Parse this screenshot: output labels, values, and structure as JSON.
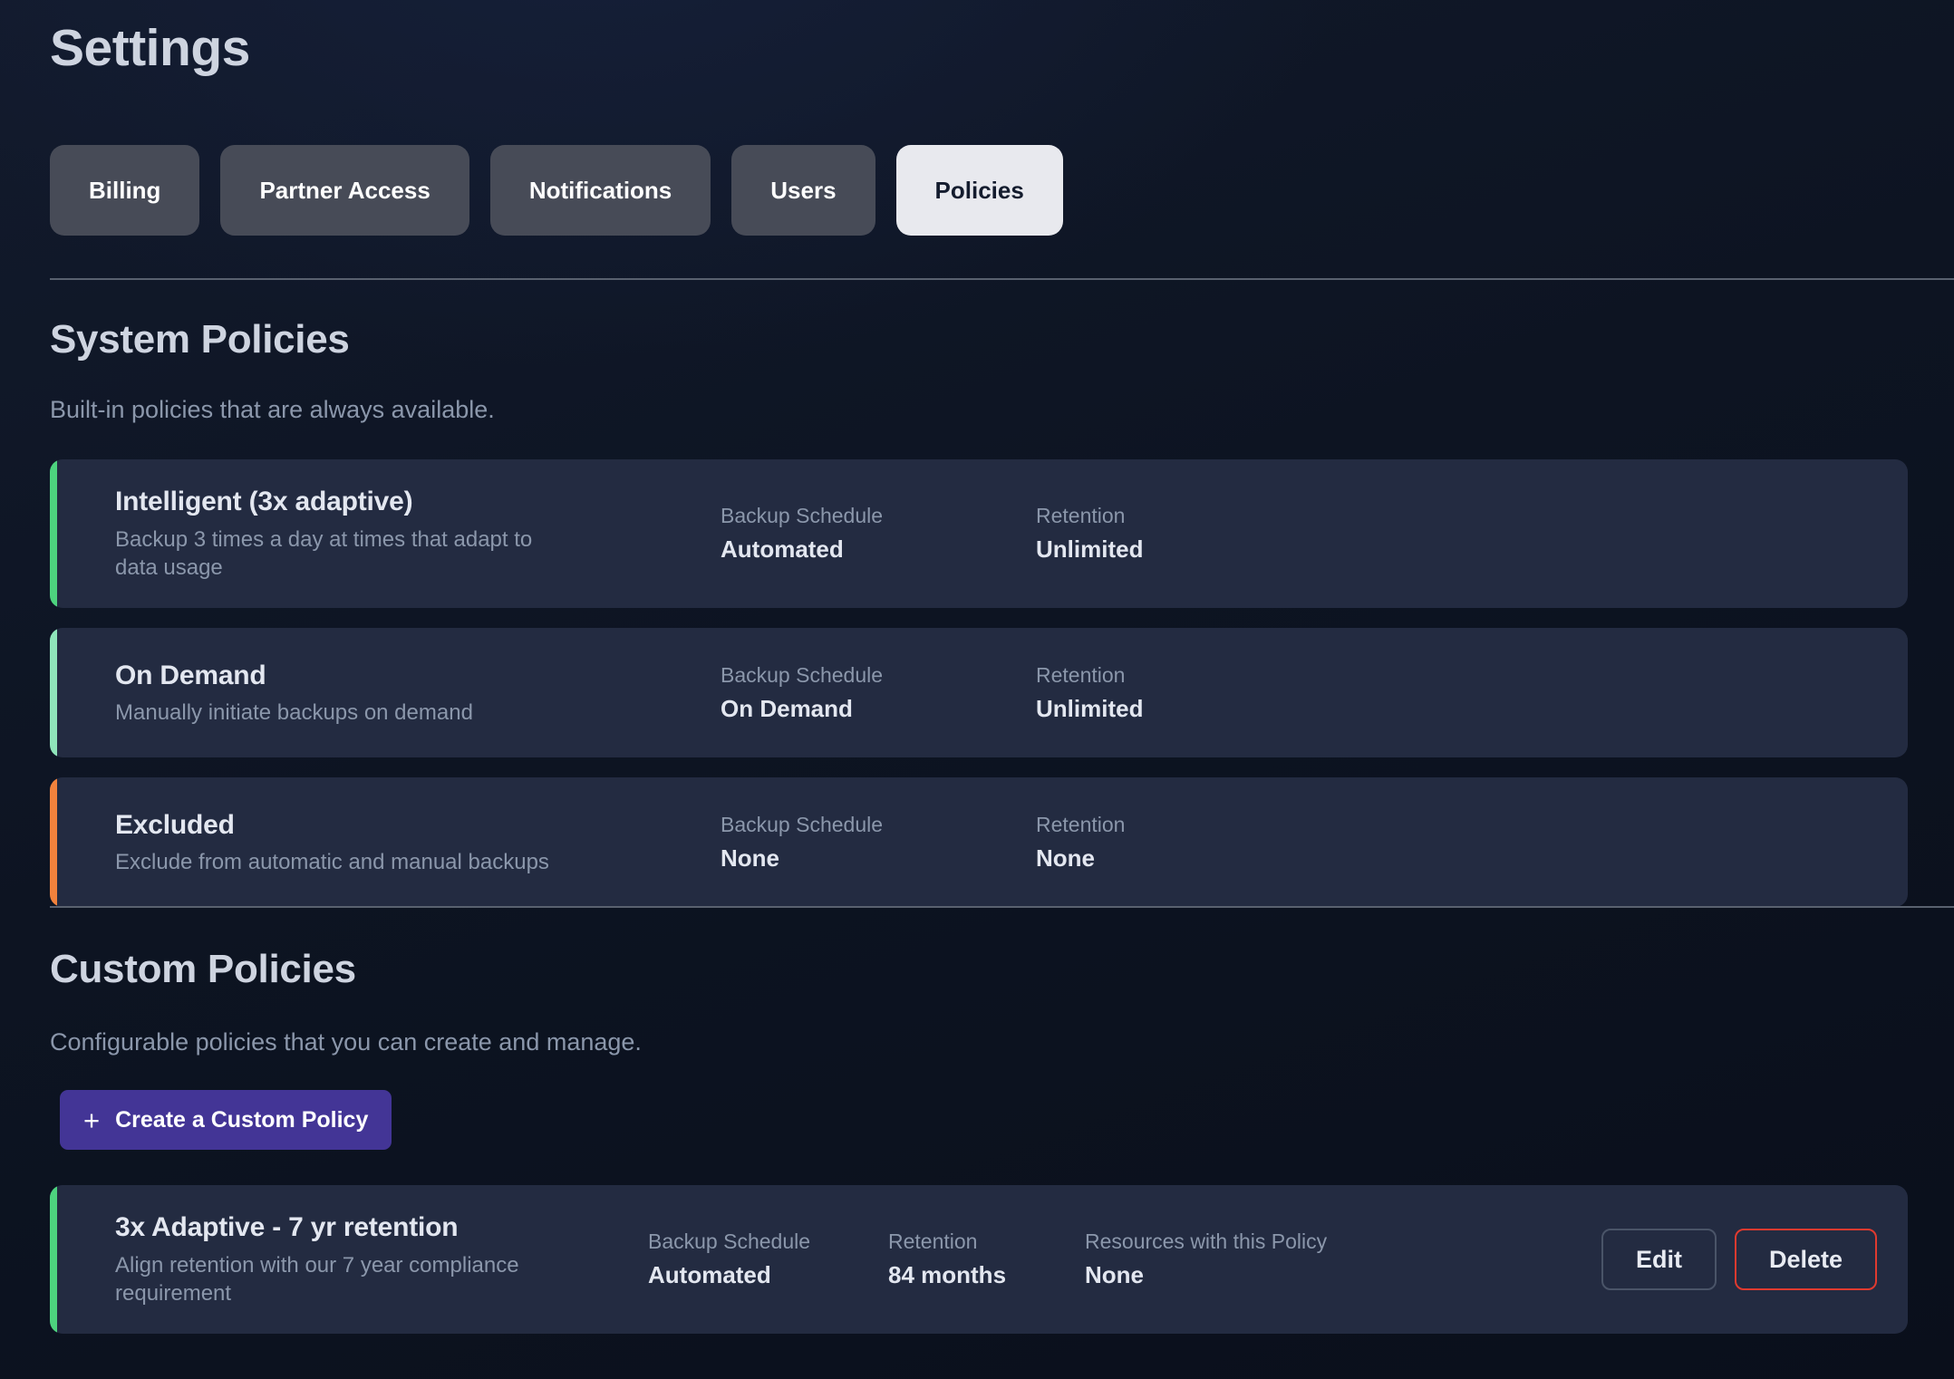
{
  "header": {
    "title": "Settings"
  },
  "tabs": [
    {
      "label": "Billing",
      "active": false
    },
    {
      "label": "Partner Access",
      "active": false
    },
    {
      "label": "Notifications",
      "active": false
    },
    {
      "label": "Users",
      "active": false
    },
    {
      "label": "Policies",
      "active": true
    }
  ],
  "system_section": {
    "title": "System Policies",
    "subtitle": "Built-in policies that are always available.",
    "policies": [
      {
        "name": "Intelligent (3x adaptive)",
        "description": "Backup 3 times a day at times that adapt to data usage",
        "accent_color": "#4dd37e",
        "fields": [
          {
            "label": "Backup Schedule",
            "value": "Automated"
          },
          {
            "label": "Retention",
            "value": "Unlimited"
          }
        ]
      },
      {
        "name": "On Demand",
        "description": "Manually initiate backups on demand",
        "accent_color": "#8fe5ba",
        "fields": [
          {
            "label": "Backup Schedule",
            "value": "On Demand"
          },
          {
            "label": "Retention",
            "value": "Unlimited"
          }
        ]
      },
      {
        "name": "Excluded",
        "description": "Exclude from automatic and manual backups",
        "accent_color": "#f2823c",
        "fields": [
          {
            "label": "Backup Schedule",
            "value": "None"
          },
          {
            "label": "Retention",
            "value": "None"
          }
        ]
      }
    ]
  },
  "custom_section": {
    "title": "Custom Policies",
    "subtitle": "Configurable policies that you can create and manage.",
    "create_button": {
      "label": "Create a Custom Policy",
      "icon": "plus-icon",
      "color": "#433596"
    },
    "policies": [
      {
        "name": "3x Adaptive - 7 yr retention",
        "description": "Align retention with our 7 year compliance requirement",
        "accent_color": "#4dd37e",
        "fields": [
          {
            "label": "Backup Schedule",
            "value": "Automated"
          },
          {
            "label": "Retention",
            "value": "84 months"
          },
          {
            "label": "Resources with this Policy",
            "value": "None"
          }
        ],
        "actions": [
          {
            "label": "Edit",
            "style": "neutral"
          },
          {
            "label": "Delete",
            "style": "danger"
          }
        ]
      }
    ]
  }
}
